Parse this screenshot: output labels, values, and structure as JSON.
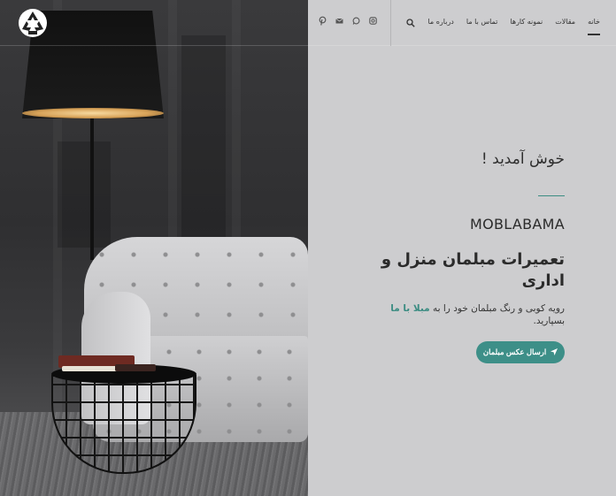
{
  "header": {
    "logo_icon": "recycle-icon",
    "nav": [
      {
        "label": "خانه",
        "active": true
      },
      {
        "label": "مقالات",
        "active": false
      },
      {
        "label": "نمونه کارها",
        "active": false
      },
      {
        "label": "تماس با ما",
        "active": false
      },
      {
        "label": "درباره ما",
        "active": false
      }
    ],
    "search_icon": "search-icon",
    "social_icons": [
      "pinterest-icon",
      "email-icon",
      "whatsapp-icon",
      "instagram-icon"
    ]
  },
  "hero": {
    "welcome": "خوش آمدید !",
    "brand": "MOBLABAMA",
    "headline": "تعمیرات مبلمان منزل و اداری",
    "description_prefix": "رویه کوبی و رنگ مبلمان خود را به",
    "description_accent": "مبلا با ما",
    "description_suffix": "بسپارید.",
    "cta_label": "ارسال عکس مبلمان",
    "cta_icon": "send-icon",
    "accent_color": "#3d8f88"
  }
}
